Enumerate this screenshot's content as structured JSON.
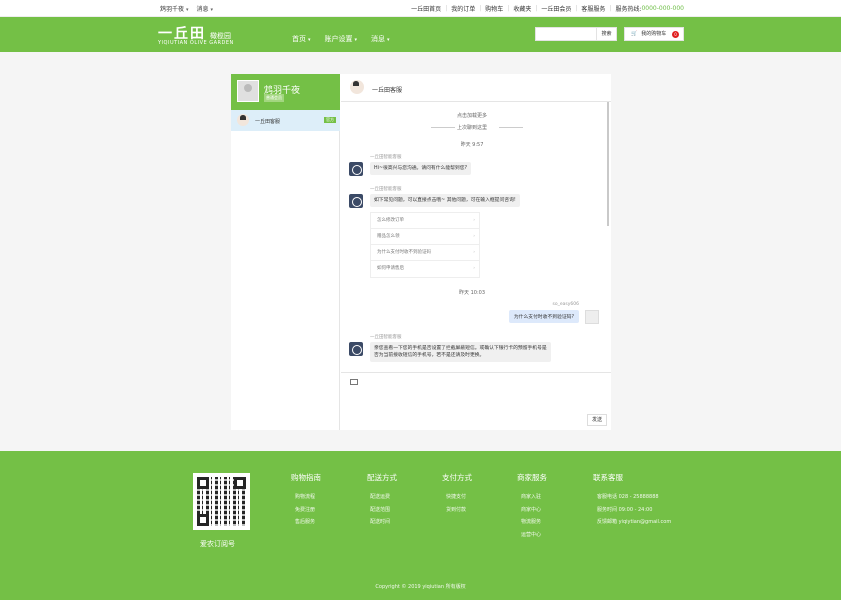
{
  "topbar": {
    "user": "鸩羽千夜",
    "messages": "消息",
    "links": [
      "一丘田首页",
      "我的订单",
      "购物车",
      "收藏夹",
      "一丘田会员",
      "客服服务"
    ],
    "hotline_label": "服务热线:",
    "hotline": "0000-000-000"
  },
  "header": {
    "logo_cn": "一丘田",
    "logo_sub": "橄榄园",
    "logo_en": "YIQIUTIAN  OLIVE GARDEN",
    "nav": [
      "首页",
      "账户设置",
      "消息"
    ],
    "search_btn": "搜索",
    "cart_label": "我的购物车",
    "cart_count": "0"
  },
  "sidebar": {
    "username": "鸩羽千夜",
    "user_badge": "普通会员",
    "contact_name": "一丘田客服",
    "contact_tag": "官方"
  },
  "chat": {
    "title": "一丘田客服",
    "load_more": "点击加载更多",
    "history_label": "上次聊到这里",
    "time1": "昨天  9:57",
    "bot_name": "一丘田智能客服",
    "msg1": "Hi~很高兴与您沟通。请问有什么能帮到您?",
    "msg2": "如下常见问题，可以直接点击哦~ 其他问题，可在输入框提问咨询!",
    "faq": [
      "怎么修改订单",
      "赠品怎么领",
      "为什么支付时收不到验证码",
      "如何申请售后"
    ],
    "time2": "昨天  10:03",
    "me_name": "so_easy606",
    "me_msg": "为什么支付时收不到验证码?",
    "msg3_line1": "亲您查看一下您的手机是否设置了拦截屏蔽短信。或确认下银行卡的预留手机号是",
    "msg3_line2": "否为当前接收短信的手机号，若不是还请及时更换。",
    "send": "发送"
  },
  "footer": {
    "qr_caption": "爱农订阅号",
    "columns": [
      {
        "title": "购物指南",
        "items": [
          "购物流程",
          "免费注册",
          "售后服务"
        ]
      },
      {
        "title": "配送方式",
        "items": [
          "配送运费",
          "配送范围",
          "配送时间"
        ]
      },
      {
        "title": "支付方式",
        "items": [
          "快捷支付",
          "货到付款"
        ]
      },
      {
        "title": "商家服务",
        "items": [
          "商家入驻",
          "商家中心",
          "物流服务",
          "运营中心"
        ]
      },
      {
        "title": "联系客服",
        "items": [
          "客服电话  028 - 25888888",
          "服务时间  09:00 - 24:00",
          "反馈邮箱  yiqiytian@gmail.com"
        ]
      }
    ],
    "copyright": "Copyright © 2019 yiqiutian 所有版权"
  },
  "colors": {
    "brand_green": "#74c046",
    "bubble_me": "#dde9fb",
    "badge_red": "#e02020"
  }
}
